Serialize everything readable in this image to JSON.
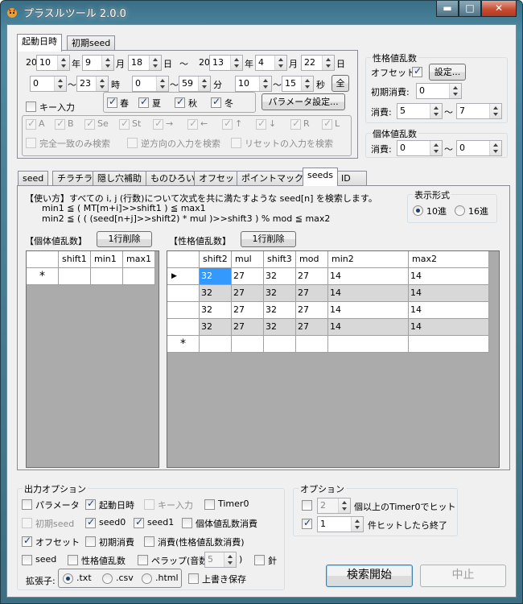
{
  "window": {
    "title": "プラスルツール 2.0.0",
    "minimize": "▬",
    "maximize": "□",
    "close": "✕"
  },
  "launch_tabs": [
    "起動日時",
    "初期seed"
  ],
  "date": {
    "y_prefix1": "20",
    "y1": "10",
    "y_unit": "年",
    "m1": "9",
    "m_unit": "月",
    "d1": "18",
    "d_unit": "日",
    "tilde": "〜",
    "y_prefix2": "20",
    "y2": "13",
    "m2": "4",
    "d2": "22"
  },
  "time": {
    "h1": "0",
    "h2": "23",
    "h_unit": "時",
    "min1": "0",
    "min2": "59",
    "min_unit": "分",
    "s1": "10",
    "s2": "15",
    "s_unit": "秒",
    "all_btn": "全"
  },
  "key_input": "キー入力",
  "seasons": [
    "春",
    "夏",
    "秋",
    "冬"
  ],
  "param_btn": "パラメータ設定...",
  "keys": [
    "A",
    "B",
    "Se",
    "St",
    "→",
    "←",
    "↑",
    "↓",
    "R",
    "L"
  ],
  "key_opts": [
    "完全一致のみ検索",
    "逆方向の入力を検索",
    "リセットの入力を検索"
  ],
  "nature": {
    "title": "性格値乱数",
    "offset_label": "オフセット:",
    "settings_btn": "設定...",
    "init_label": "初期消費:",
    "init_val": "0",
    "consume_label": "消費:",
    "c1": "5",
    "c2": "7",
    "tilde": "〜"
  },
  "indiv": {
    "title": "個体値乱数",
    "consume_label": "消費:",
    "c1": "0",
    "c2": "0",
    "tilde": "〜"
  },
  "main_tabs": [
    "seed",
    "チラチラ",
    "隠し穴補助",
    "ものひろい",
    "オフセット",
    "ポイントマックス",
    "seeds",
    "ID"
  ],
  "usage": {
    "line1": "【使い方】すべての i, j (行数)について次式を共に満たすような seed[n] を検索します。",
    "line2": "min1 ≦ ( MT[m+i]>>shift1 ) ≦ max1",
    "line3": "min2 ≦ ( ( (seed[n+j]>>shift2) * mul )>>shift3 ) % mod ≦ max2"
  },
  "display": {
    "title": "表示形式",
    "dec": "10進",
    "hex": "16進"
  },
  "indiv_grid": {
    "title": "【個体値乱数】",
    "delete_btn": "1行削除",
    "columns": [
      "shift1",
      "min1",
      "max1"
    ],
    "new_row": "*"
  },
  "nature_grid": {
    "title": "【性格値乱数】",
    "delete_btn": "1行削除",
    "columns": [
      "shift2",
      "mul",
      "shift3",
      "mod",
      "min2",
      "max2"
    ],
    "rows": [
      [
        "32",
        "27",
        "32",
        "27",
        "14",
        "14"
      ],
      [
        "32",
        "27",
        "32",
        "27",
        "14",
        "14"
      ],
      [
        "32",
        "27",
        "32",
        "27",
        "14",
        "14"
      ],
      [
        "32",
        "27",
        "32",
        "27",
        "14",
        "14"
      ]
    ],
    "current_marker": "▶",
    "new_row": "*"
  },
  "output": {
    "title": "出力オプション",
    "items": [
      [
        "パラメータ",
        "起動日時",
        "キー入力",
        "Timer0"
      ],
      [
        "初期seed",
        "seed0",
        "seed1",
        "個体値乱数消費"
      ],
      [
        "オフセット",
        "初期消費",
        "消費(性格値乱数消費)"
      ],
      [
        "seed",
        "性格値乱数",
        "ペラップ(音数:",
        "針"
      ]
    ],
    "pelap_val": "5",
    "pelap_close": ")",
    "ext_label": "拡張子:",
    "ext": [
      ".txt",
      ".csv",
      ".html"
    ],
    "overwrite": "上書き保存"
  },
  "options": {
    "title": "オプション",
    "timer0_val": "2",
    "timer0_label": "個以上のTimer0でヒット",
    "hit_val": "1",
    "hit_label": "件ヒットしたら終了"
  },
  "search_btn": "検索開始",
  "stop_btn": "中止"
}
